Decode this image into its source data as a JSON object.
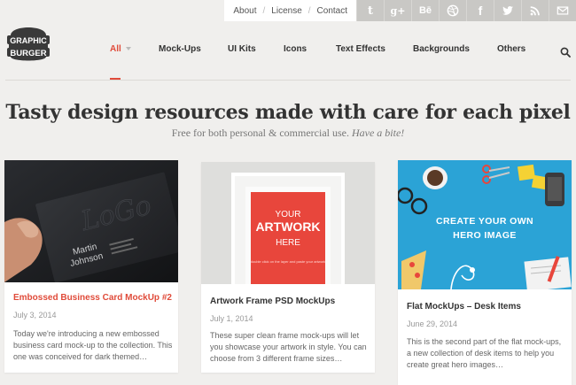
{
  "top_links": [
    "About",
    "License",
    "Contact"
  ],
  "social_icons": [
    {
      "name": "tumblr-icon",
      "glyph": "t"
    },
    {
      "name": "google-plus-icon",
      "glyph": "g+"
    },
    {
      "name": "behance-icon",
      "glyph": "Bē"
    },
    {
      "name": "dribbble-icon",
      "glyph": ""
    },
    {
      "name": "facebook-icon",
      "glyph": "f"
    },
    {
      "name": "twitter-icon",
      "glyph": ""
    },
    {
      "name": "rss-icon",
      "glyph": ""
    },
    {
      "name": "email-icon",
      "glyph": ""
    }
  ],
  "logo": {
    "line1": "GRAPHIC",
    "line2": "BURGER"
  },
  "nav": {
    "items": [
      "All",
      "Mock-Ups",
      "UI Kits",
      "Icons",
      "Text Effects",
      "Backgrounds",
      "Others"
    ]
  },
  "hero": {
    "title": "Tasty design resources made with care for each pixel",
    "subtitle": "Free for both personal & commercial use.",
    "subtitle_em": "Have a bite!"
  },
  "cards": [
    {
      "title": "Embossed Business Card MockUp #2",
      "date": "July 3, 2014",
      "desc": "Today we're introducing a new embossed business card mock-up to the collection. This one was conceived for dark themed…",
      "art": {
        "logo": "LoGo",
        "first": "Martin",
        "last": "Johnson"
      }
    },
    {
      "title": "Artwork Frame PSD MockUps",
      "date": "July 1, 2014",
      "desc": "These super clean frame mock-ups will let you showcase your artwork in style. You can choose from 3 different frame sizes…",
      "art": {
        "l1": "YOUR",
        "l2": "ARTWORK",
        "l3": "HERE",
        "small": "double click on the layer and paste your artwork"
      }
    },
    {
      "title": "Flat MockUps – Desk Items",
      "date": "June 29, 2014",
      "desc": "This is the second part of the flat mock-ups, a new collection of desk items to help you create great hero images…",
      "art": {
        "l1": "CREATE YOUR OWN",
        "l2": "HERO IMAGE"
      }
    }
  ],
  "colors": {
    "accent": "#e04b3a",
    "background": "#f0efed",
    "social_bg": "#c9c8c5"
  }
}
